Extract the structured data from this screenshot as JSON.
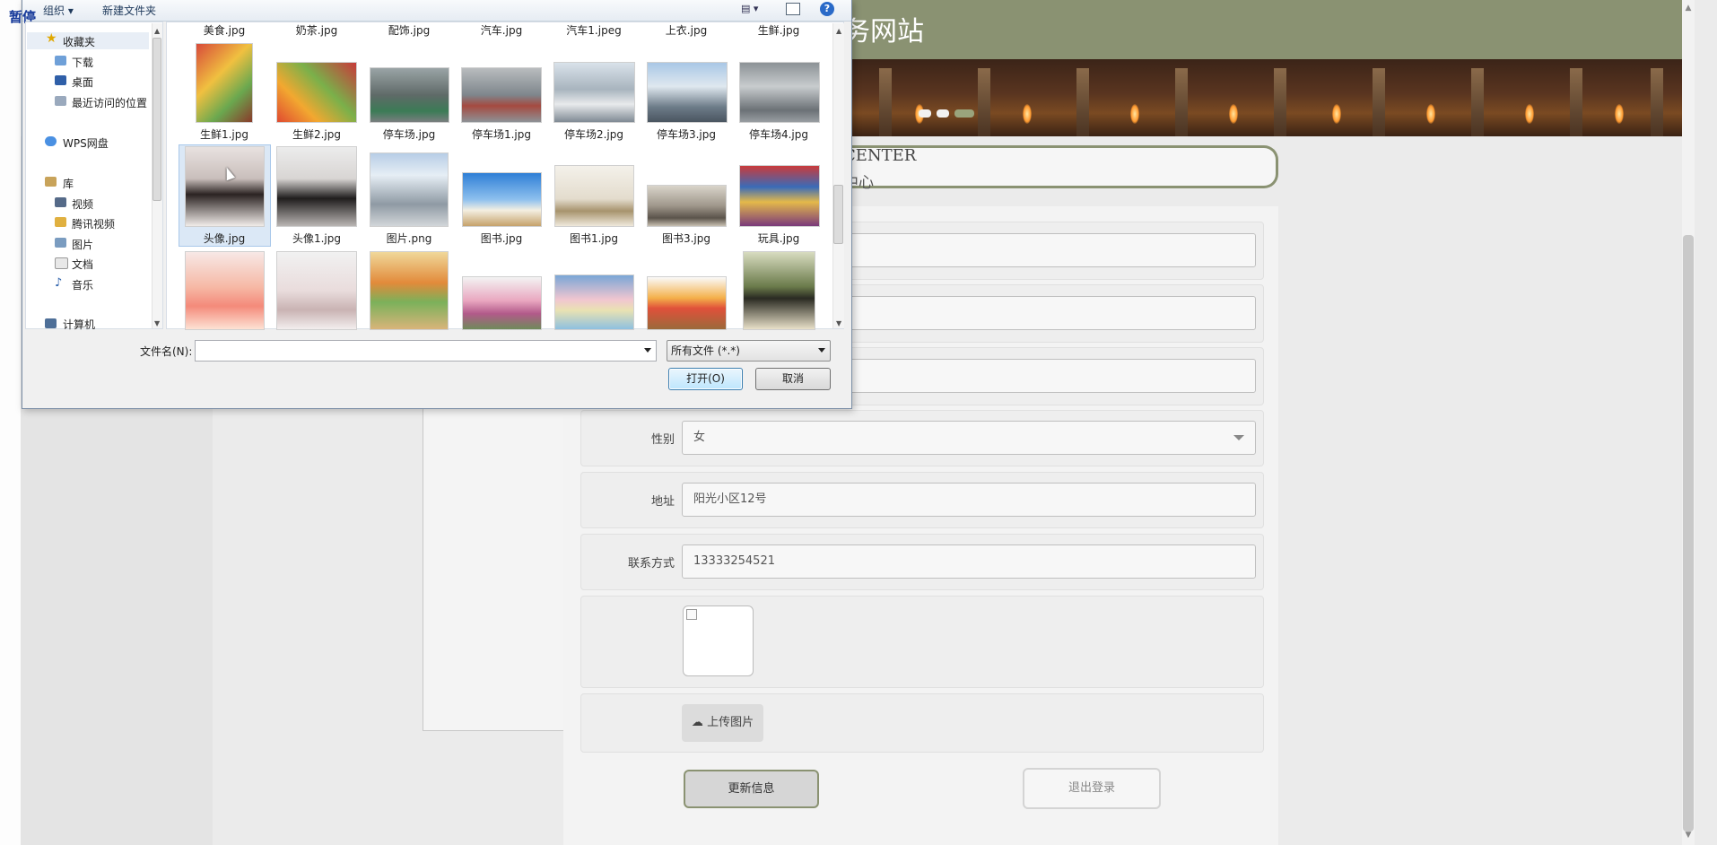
{
  "overlay": {
    "pause_label": "暂停"
  },
  "dialog": {
    "toolbar": {
      "organize": "组织 ▾",
      "new_folder": "新建文件夹",
      "help": "?",
      "view": "▤ ▾"
    },
    "nav": {
      "favorites": "收藏夹",
      "downloads": "下载",
      "desktop": "桌面",
      "recent": "最近访问的位置",
      "wps": "WPS网盘",
      "library": "库",
      "videos": "视频",
      "tencent_video": "腾讯视频",
      "pictures": "图片",
      "documents": "文档",
      "music": "音乐",
      "computer": "计算机"
    },
    "top_row_names": [
      "美食.jpg",
      "奶茶.jpg",
      "配饰.jpg",
      "汽车.jpg",
      "汽车1.jpeg",
      "上衣.jpg",
      "生鲜.jpg"
    ],
    "files_row1": [
      "生鲜1.jpg",
      "生鲜2.jpg",
      "停车场.jpg",
      "停车场1.jpg",
      "停车场2.jpg",
      "停车场3.jpg",
      "停车场4.jpg"
    ],
    "files_row2": [
      "头像.jpg",
      "头像1.jpg",
      "图片.png",
      "图书.jpg",
      "图书1.jpg",
      "图书3.jpg",
      "玩具.jpg"
    ],
    "filename_label": "文件名(N):",
    "filename_value": "",
    "filetype": "所有文件 (*.*)",
    "open_button": "打开(O)",
    "cancel_button": "取消"
  },
  "page": {
    "site_title": "务网站",
    "center_en": "CENTER",
    "center_cn": "中心",
    "form": {
      "gender_label": "性别",
      "gender_value": "女",
      "address_label": "地址",
      "address_value": "阳光小区12号",
      "phone_label": "联系方式",
      "phone_value": "13333254521",
      "upload_button": "上传图片",
      "update_button": "更新信息",
      "logout_button": "退出登录"
    }
  }
}
